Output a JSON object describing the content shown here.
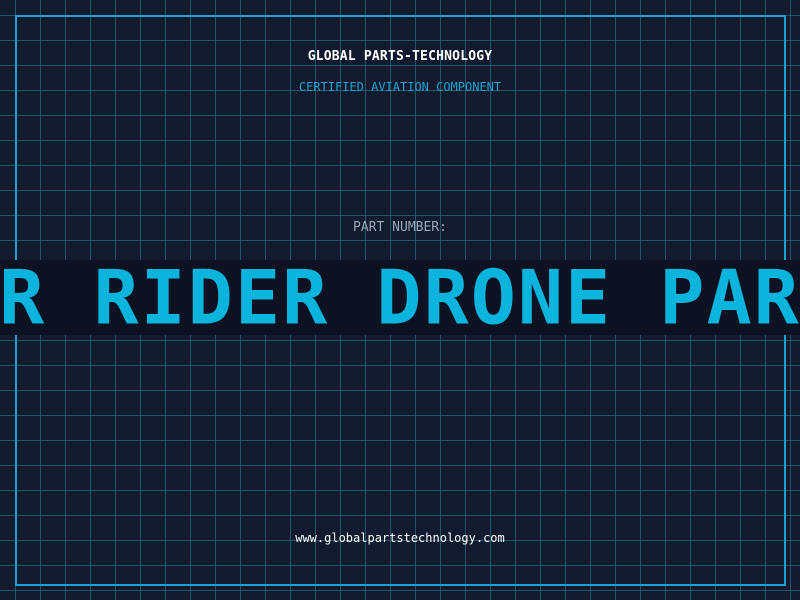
{
  "header": {
    "company": "GLOBAL PARTS-TECHNOLOGY",
    "subtitle": "CERTIFIED AVIATION COMPONENT"
  },
  "part": {
    "label": "PART NUMBER:",
    "name": "AIR RIDER DRONE PARTS"
  },
  "footer": {
    "url": "www.globalpartstechnology.com"
  },
  "colors": {
    "background": "#111a2e",
    "grid": "#26687c",
    "accent": "#1aa3d1",
    "band": "#0c1222",
    "part_text": "#0ab4dd"
  }
}
